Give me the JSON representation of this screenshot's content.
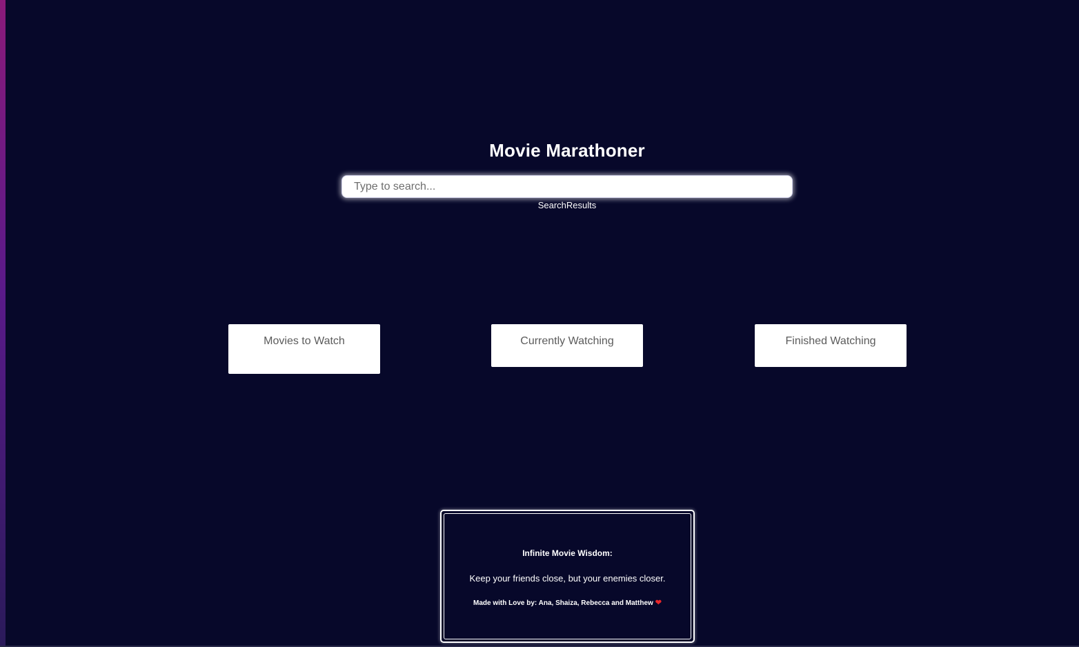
{
  "app": {
    "title": "Movie Marathoner"
  },
  "search": {
    "placeholder": "Type to search...",
    "value": "",
    "results_label": "SearchResults"
  },
  "lists": [
    {
      "label": "Movies to Watch"
    },
    {
      "label": "Currently Watching"
    },
    {
      "label": "Finished Watching"
    }
  ],
  "footer": {
    "wisdom_label": "Infinite Movie Wisdom:",
    "quote": "Keep your friends close, but your enemies closer.",
    "credits": "Made with Love by: Ana, Shaiza, Rebecca and Matthew",
    "heart_icon": "heart-icon",
    "heart_color": "#e8262a"
  },
  "colors": {
    "background": "#07082a",
    "accent_edge": "#8a1a7a"
  }
}
